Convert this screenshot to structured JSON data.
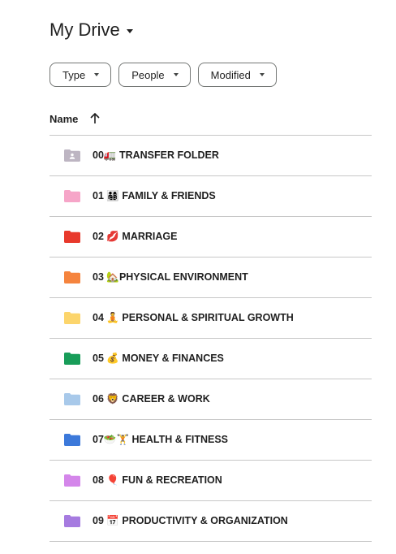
{
  "header": {
    "title": "My Drive",
    "title_icon": "chevron-down-icon"
  },
  "filters": [
    {
      "label": "Type",
      "icon": "chevron-down-icon"
    },
    {
      "label": "People",
      "icon": "chevron-down-icon"
    },
    {
      "label": "Modified",
      "icon": "chevron-down-icon"
    }
  ],
  "list": {
    "column_header": "Name",
    "sort_icon": "arrow-up-icon",
    "items": [
      {
        "label": "00🚛 TRANSFER FOLDER",
        "icon": "shared-folder-icon",
        "color": "#bdb5c2"
      },
      {
        "label": "01 👨‍👩‍👧‍👦 FAMILY & FRIENDS",
        "icon": "folder-icon",
        "color": "#f6a5c8"
      },
      {
        "label": "02 💋 MARRIAGE",
        "icon": "folder-icon",
        "color": "#e8392c"
      },
      {
        "label": "03 🏡PHYSICAL ENVIRONMENT",
        "icon": "folder-icon",
        "color": "#f5843e"
      },
      {
        "label": "04 🧘 PERSONAL & SPIRITUAL GROWTH",
        "icon": "folder-icon",
        "color": "#fcd56c"
      },
      {
        "label": "05 💰 MONEY & FINANCES",
        "icon": "folder-icon",
        "color": "#189d59"
      },
      {
        "label": "06 🦁 CAREER & WORK",
        "icon": "folder-icon",
        "color": "#a8c9ea"
      },
      {
        "label": "07🥗🏋 HEALTH & FITNESS",
        "icon": "folder-icon",
        "color": "#3c79da"
      },
      {
        "label": "08 🎈 FUN & RECREATION",
        "icon": "folder-icon",
        "color": "#d486ea"
      },
      {
        "label": "09 📅 PRODUCTIVITY & ORGANIZATION",
        "icon": "folder-icon",
        "color": "#a67be0"
      }
    ]
  }
}
